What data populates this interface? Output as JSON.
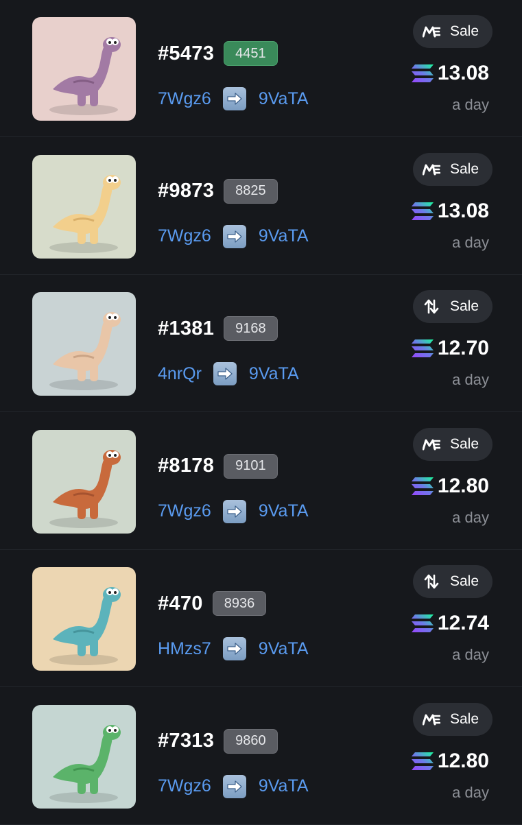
{
  "sales": [
    {
      "token": "#5473",
      "rank": "4451",
      "rank_highlight": true,
      "from": "7Wgz6",
      "to": "9VaTA",
      "marketplace_icon": "magic-eden-icon",
      "type": "Sale",
      "price": "13.08",
      "time": "a day",
      "bg": "#e8d0cc",
      "body": "#a27aa4",
      "accent": "#6e4a70"
    },
    {
      "token": "#9873",
      "rank": "8825",
      "rank_highlight": false,
      "from": "7Wgz6",
      "to": "9VaTA",
      "marketplace_icon": "magic-eden-icon",
      "type": "Sale",
      "price": "13.08",
      "time": "a day",
      "bg": "#d7dccb",
      "body": "#f2cf8c",
      "accent": "#c89a52"
    },
    {
      "token": "#1381",
      "rank": "9168",
      "rank_highlight": false,
      "from": "4nrQr",
      "to": "9VaTA",
      "marketplace_icon": "exchange-arrows-icon",
      "type": "Sale",
      "price": "12.70",
      "time": "a day",
      "bg": "#c9d3d4",
      "body": "#e9c6a8",
      "accent": "#b68e70"
    },
    {
      "token": "#8178",
      "rank": "9101",
      "rank_highlight": false,
      "from": "7Wgz6",
      "to": "9VaTA",
      "marketplace_icon": "magic-eden-icon",
      "type": "Sale",
      "price": "12.80",
      "time": "a day",
      "bg": "#cfd8cc",
      "body": "#c86a3c",
      "accent": "#8e4326"
    },
    {
      "token": "#470",
      "rank": "8936",
      "rank_highlight": false,
      "from": "HMzs7",
      "to": "9VaTA",
      "marketplace_icon": "exchange-arrows-icon",
      "type": "Sale",
      "price": "12.74",
      "time": "a day",
      "bg": "#ecd6b2",
      "body": "#5cb3bb",
      "accent": "#367e86"
    },
    {
      "token": "#7313",
      "rank": "9860",
      "rank_highlight": false,
      "from": "7Wgz6",
      "to": "9VaTA",
      "marketplace_icon": "magic-eden-icon",
      "type": "Sale",
      "price": "12.80",
      "time": "a day",
      "bg": "#c5d6d2",
      "body": "#5bb36a",
      "accent": "#32803f"
    }
  ]
}
